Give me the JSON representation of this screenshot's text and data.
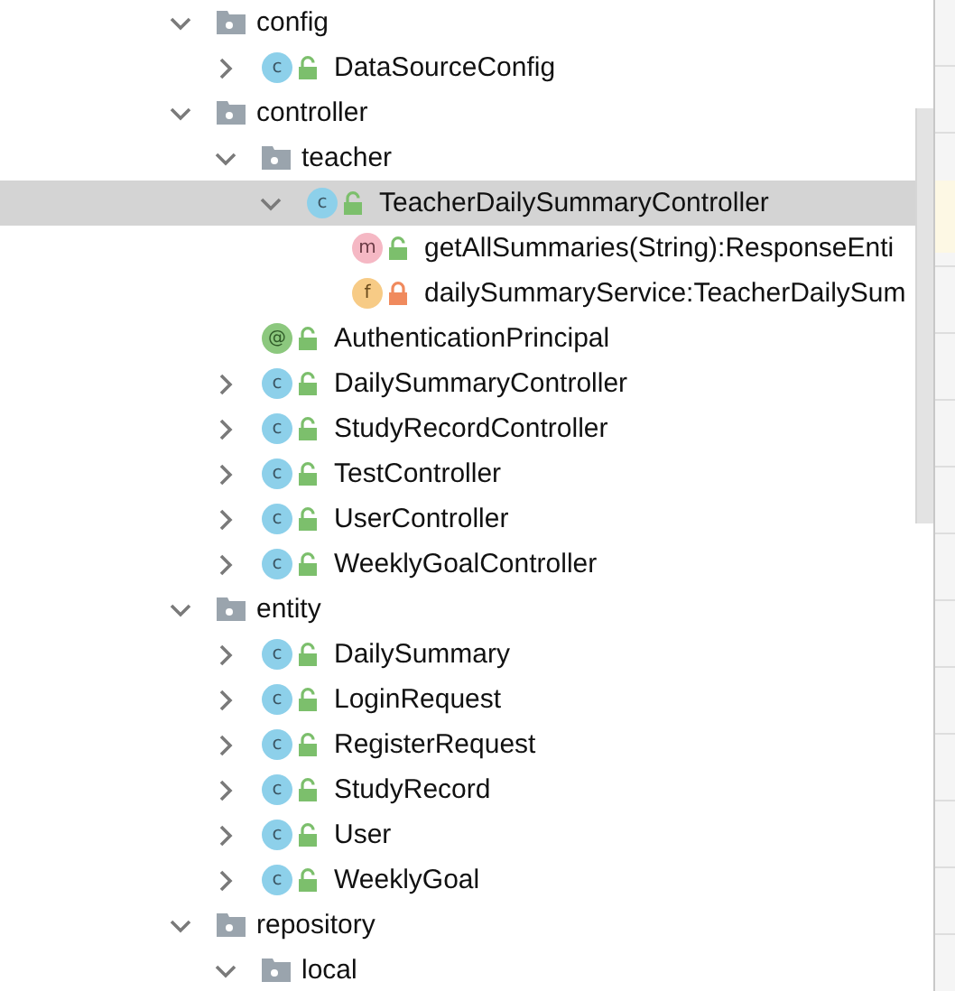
{
  "tree": [
    {
      "kind": "folder",
      "label": "config",
      "expanded": true,
      "children": [
        {
          "kind": "class",
          "badge": "c",
          "locked": false,
          "label": "DataSourceConfig",
          "expanded": false
        }
      ]
    },
    {
      "kind": "folder",
      "label": "controller",
      "expanded": true,
      "children": [
        {
          "kind": "folder",
          "label": "teacher",
          "expanded": true,
          "children": [
            {
              "kind": "class",
              "badge": "c",
              "locked": false,
              "label": "TeacherDailySummaryController",
              "expanded": true,
              "selected": true,
              "children": [
                {
                  "kind": "method",
                  "badge": "m",
                  "locked": false,
                  "label": "getAllSummaries(String):ResponseEnti",
                  "selected": false
                },
                {
                  "kind": "field",
                  "badge": "f",
                  "locked": true,
                  "label": "dailySummaryService:TeacherDailySum",
                  "selected": false
                }
              ]
            }
          ]
        },
        {
          "kind": "annotation",
          "badge": "@",
          "locked": false,
          "label": "AuthenticationPrincipal",
          "selected": false
        },
        {
          "kind": "class",
          "badge": "c",
          "locked": false,
          "label": "DailySummaryController",
          "expanded": false,
          "selected": false
        },
        {
          "kind": "class",
          "badge": "c",
          "locked": false,
          "label": "StudyRecordController",
          "expanded": false,
          "selected": false
        },
        {
          "kind": "class",
          "badge": "c",
          "locked": false,
          "label": "TestController",
          "expanded": false,
          "selected": false
        },
        {
          "kind": "class",
          "badge": "c",
          "locked": false,
          "label": "UserController",
          "expanded": false,
          "selected": false
        },
        {
          "kind": "class",
          "badge": "c",
          "locked": false,
          "label": "WeeklyGoalController",
          "expanded": false,
          "selected": false
        }
      ]
    },
    {
      "kind": "folder",
      "label": "entity",
      "expanded": true,
      "children": [
        {
          "kind": "class",
          "badge": "c",
          "locked": false,
          "label": "DailySummary",
          "expanded": false,
          "selected": false
        },
        {
          "kind": "class",
          "badge": "c",
          "locked": false,
          "label": "LoginRequest",
          "expanded": false,
          "selected": false
        },
        {
          "kind": "class",
          "badge": "c",
          "locked": false,
          "label": "RegisterRequest",
          "expanded": false,
          "selected": false
        },
        {
          "kind": "class",
          "badge": "c",
          "locked": false,
          "label": "StudyRecord",
          "expanded": false,
          "selected": false
        },
        {
          "kind": "class",
          "badge": "c",
          "locked": false,
          "label": "User",
          "expanded": false,
          "selected": false
        },
        {
          "kind": "class",
          "badge": "c",
          "locked": false,
          "label": "WeeklyGoal",
          "expanded": false,
          "selected": false
        }
      ]
    },
    {
      "kind": "folder",
      "label": "repository",
      "expanded": true,
      "children": [
        {
          "kind": "folder",
          "label": "local",
          "expanded": true
        }
      ]
    }
  ]
}
